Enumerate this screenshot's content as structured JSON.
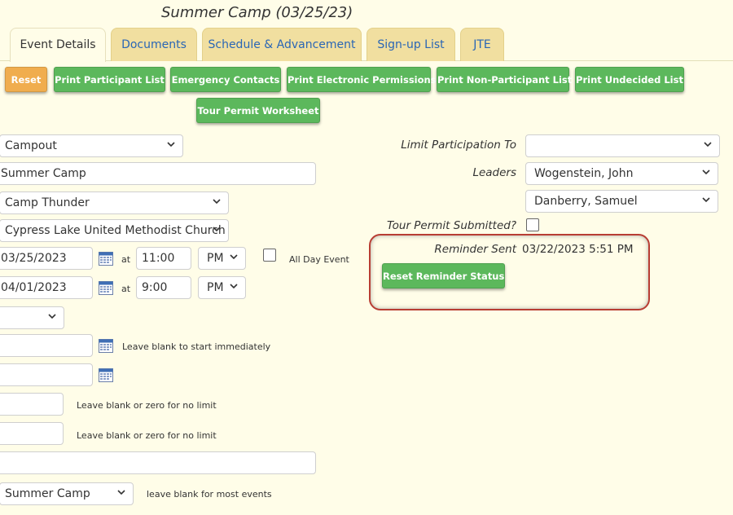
{
  "page_title": "Summer Camp (03/25/23)",
  "tabs": [
    {
      "label": "Event Details"
    },
    {
      "label": "Documents"
    },
    {
      "label": "Schedule & Advancement"
    },
    {
      "label": "Sign-up List"
    },
    {
      "label": "JTE"
    }
  ],
  "buttons": {
    "reset": "Reset",
    "print_participant_list": "Print Participant List",
    "emergency_contacts": "Emergency Contacts",
    "print_electronic_permissions": "Print Electronic Permissions",
    "print_non_participant_list": "Print Non-Participant List",
    "print_undecided_list": "Print Undecided List",
    "tour_permit_worksheet": "Tour Permit Worksheet",
    "reset_reminder_status": "Reset Reminder Status"
  },
  "form": {
    "event_type": "Campout",
    "event_name": "Summer Camp",
    "location": "Camp Thunder",
    "meeting_place": "Cypress Lake United Methodist Church",
    "start_date": "03/25/2023",
    "start_time": "11:00",
    "start_ampm": "PM",
    "at_label": "at",
    "all_day_label": "All Day Event",
    "end_date": "04/01/2023",
    "end_time": "9:00",
    "end_ampm": "PM",
    "hint_start_immediately": "Leave blank to start immediately",
    "hint_no_limit_1": "Leave blank or zero for no limit",
    "hint_no_limit_2": "Leave blank or zero for no limit",
    "bottom_select": "Summer Camp",
    "hint_most_events": "leave blank for most events"
  },
  "right": {
    "limit_label": "Limit Participation To",
    "limit_value": "",
    "leaders_label": "Leaders",
    "leader_1": "Wogenstein, John",
    "leader_2": "Danberry, Samuel",
    "tour_permit_label": "Tour Permit Submitted?",
    "reminder_label": "Reminder Sent",
    "reminder_value": "03/22/2023 5:51 PM"
  },
  "colors": {
    "background": "#fffde8",
    "tab_inactive": "#f1dfa0",
    "tab_text": "#2a66b5",
    "button_green": "#5cb85c",
    "button_orange": "#f0ad4e",
    "highlight_border": "#b83d33"
  }
}
